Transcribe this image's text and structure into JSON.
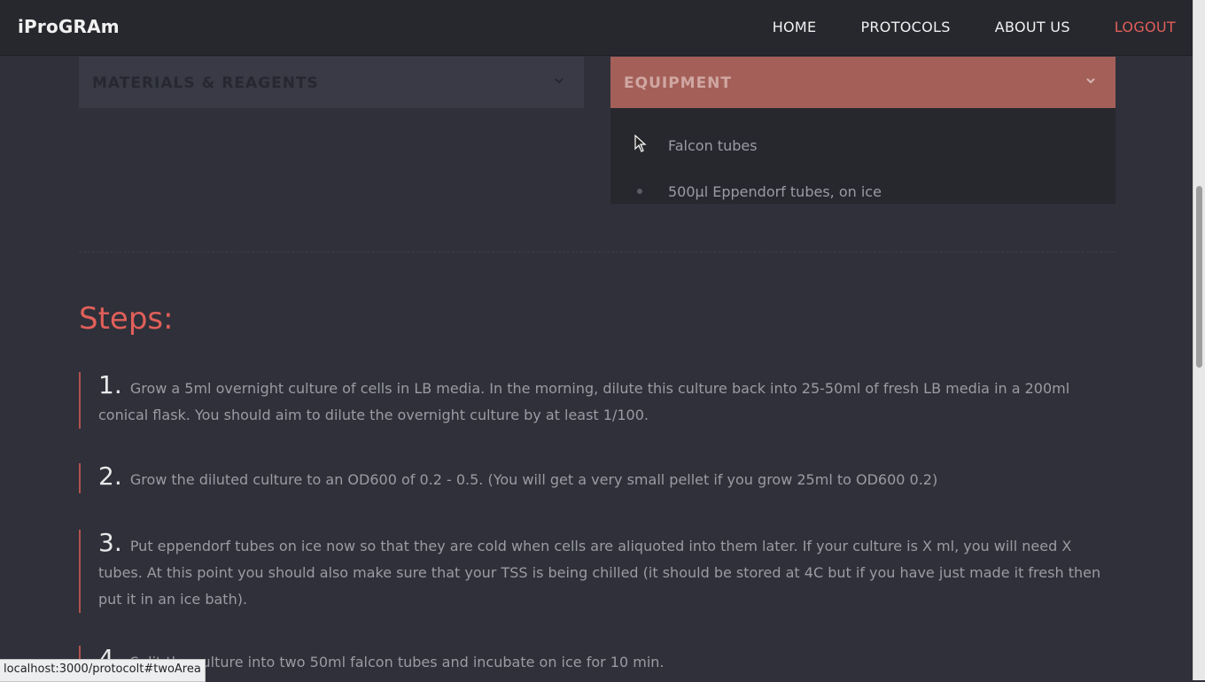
{
  "nav": {
    "brand": "iProGRAm",
    "links": [
      "HOME",
      "PROTOCOLS",
      "ABOUT US",
      "LOGOUT"
    ]
  },
  "materials_panel": {
    "title": "MATERIALS & REAGENTS",
    "icon": "chevron-down-icon"
  },
  "equipment_panel": {
    "title": "EQUIPMENT",
    "icon": "chevron-down-icon",
    "items": [
      "Falcon tubes",
      "500µl Eppendorf tubes, on ice"
    ]
  },
  "steps": {
    "title": "Steps:",
    "items": [
      {
        "num": "1.",
        "text": "Grow a 5ml overnight culture of cells in LB media. In the morning, dilute this culture back into 25-50ml of fresh LB media in a 200ml conical flask. You should aim to dilute the overnight culture by at least 1/100."
      },
      {
        "num": "2.",
        "text": "Grow the diluted culture to an OD600 of 0.2 - 0.5. (You will get a very small pellet if you grow 25ml to OD600 0.2)"
      },
      {
        "num": "3.",
        "text": "Put eppendorf tubes on ice now so that they are cold when cells are aliquoted into them later. If your culture is X ml, you will need X tubes. At this point you should also make sure that your TSS is being chilled (it should be stored at 4C but if you have just made it fresh then put it in an ice bath)."
      },
      {
        "num": "4.",
        "text": "Split the culture into two 50ml falcon tubes and incubate on ice for 10 min."
      }
    ]
  },
  "status_url": "localhost:3000/protocolt#twoArea",
  "colors": {
    "accent": "#e05f5a",
    "equipment_header": "#a45f59",
    "background": "#2f3039",
    "navbar": "#27282e"
  }
}
